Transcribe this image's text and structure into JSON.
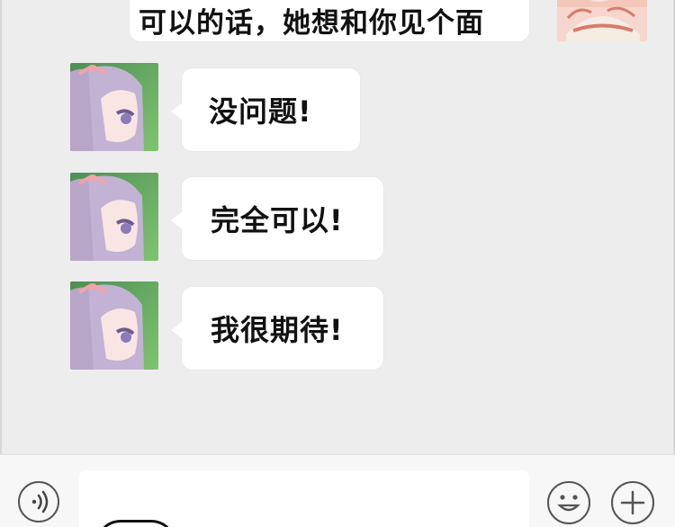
{
  "chat": {
    "messages": [
      {
        "sender": "other-top-right",
        "text": "可以的话，她想和你见个面"
      },
      {
        "sender": "girl",
        "text": "没问题!"
      },
      {
        "sender": "girl",
        "text": "完全可以!"
      },
      {
        "sender": "girl",
        "text": "我很期待!"
      }
    ]
  },
  "input_bar": {
    "voice_icon": "voice-icon",
    "emoji_icon": "emoji-icon",
    "plus_icon": "plus-icon"
  },
  "colors": {
    "chat_background": "#ededed",
    "bubble": "#ffffff",
    "text": "#111111",
    "input_bar_background": "#f7f7f7"
  }
}
